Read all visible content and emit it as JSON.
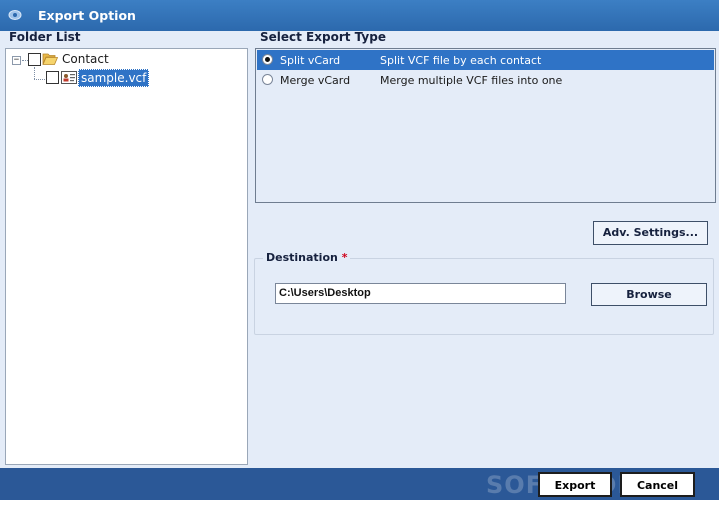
{
  "window": {
    "title": "Export Option"
  },
  "folder_list": {
    "heading": "Folder List",
    "root": {
      "label": "Contact",
      "checked": false,
      "expanded": true
    },
    "children": [
      {
        "label": "sample.vcf",
        "checked": false,
        "selected": true
      }
    ]
  },
  "export_type": {
    "heading": "Select Export Type",
    "options": [
      {
        "name": "Split vCard",
        "description": "Split VCF file by each contact",
        "selected": true
      },
      {
        "name": "Merge vCard",
        "description": "Merge multiple VCF files into one",
        "selected": false
      }
    ]
  },
  "adv_settings_label": "Adv. Settings...",
  "destination": {
    "label": "Destination",
    "required_mark": "*",
    "path": "C:\\Users\\Desktop",
    "browse_label": "Browse"
  },
  "footer": {
    "export_label": "Export",
    "cancel_label": "Cancel",
    "watermark": "SOFTPEDIA"
  },
  "colors": {
    "titlebar": "#2f6db5",
    "client": "#e4ecf8",
    "selection": "#2f73c6",
    "footer": "#2b5897"
  }
}
